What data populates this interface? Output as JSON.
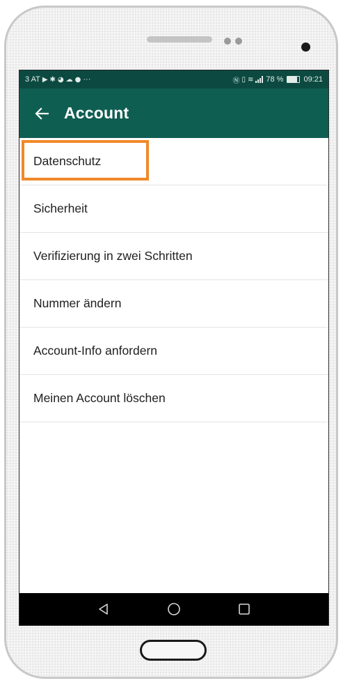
{
  "statusbar": {
    "left_text": "3 AT",
    "left_icons": [
      "play-store-icon",
      "notification-icon",
      "sync-icon",
      "cloud-icon",
      "message-icon"
    ],
    "more": "···",
    "right_icons": [
      "nfc-icon",
      "vibrate-icon",
      "wifi-icon",
      "signal-icon"
    ],
    "battery_percent_label": "78 %",
    "battery_level": 0.78,
    "time": "09:21"
  },
  "toolbar": {
    "back_icon": "arrow-left-icon",
    "title": "Account"
  },
  "menu": {
    "items": [
      {
        "label": "Datenschutz",
        "highlighted": true
      },
      {
        "label": "Sicherheit"
      },
      {
        "label": "Verifizierung in zwei Schritten"
      },
      {
        "label": "Nummer ändern"
      },
      {
        "label": "Account-Info anfordern"
      },
      {
        "label": "Meinen Account löschen"
      }
    ]
  },
  "colors": {
    "toolbar": "#0f5e52",
    "statusbar": "#0c4a41",
    "highlight": "#f0892a"
  },
  "navbar": {
    "icons": [
      "back-triangle-icon",
      "home-circle-icon",
      "recents-square-icon"
    ]
  }
}
